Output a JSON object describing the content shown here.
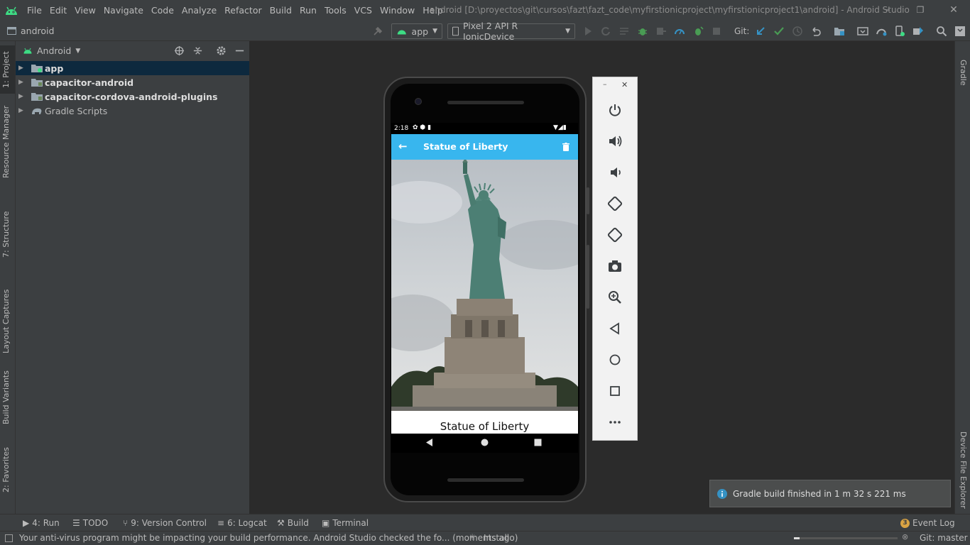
{
  "window": {
    "menu": [
      "File",
      "Edit",
      "View",
      "Navigate",
      "Code",
      "Analyze",
      "Refactor",
      "Build",
      "Run",
      "Tools",
      "VCS",
      "Window",
      "Help"
    ],
    "title": "android [D:\\proyectos\\git\\cursos\\fazt\\fazt_code\\myfirstionicproject\\myfirstionicproject1\\android] - Android Studio",
    "minimize": "–",
    "restore": "❐",
    "close": "✕"
  },
  "toolbar": {
    "breadcrumb": "android",
    "run_config": "app",
    "device": "Pixel 2 API R IonicDevice",
    "git_label": "Git:"
  },
  "left_tabs": [
    "1: Project",
    "Resource Manager",
    "7: Structure",
    "Layout Captures",
    "Build Variants",
    "2: Favorites"
  ],
  "right_tabs": [
    "Gradle",
    "Device File Explorer"
  ],
  "project_panel": {
    "view": "Android",
    "tree": [
      {
        "label": "app",
        "selected": true
      },
      {
        "label": "capacitor-android",
        "selected": false
      },
      {
        "label": "capacitor-cordova-android-plugins",
        "selected": false
      },
      {
        "label": "Gradle Scripts",
        "selected": false
      }
    ]
  },
  "emulator": {
    "status_time": "2:18",
    "app_title": "Statue of Liberty",
    "caption": "Statue of Liberty",
    "panel_icons": [
      "power-icon",
      "volume-up-icon",
      "volume-down-icon",
      "rotate-left-icon",
      "rotate-right-icon",
      "camera-icon",
      "zoom-icon",
      "back-icon",
      "home-icon",
      "overview-icon",
      "more-icon"
    ]
  },
  "notification": {
    "text": "Gradle build finished in 1 m 32 s 221 ms"
  },
  "tool_windows": {
    "run": "4: Run",
    "todo": "TODO",
    "vcs": "9: Version Control",
    "logcat": "6: Logcat",
    "build": "Build",
    "terminal": "Terminal",
    "event_log": "Event Log",
    "event_count": "3"
  },
  "status": {
    "message": "Your anti-virus program might be impacting your build performance. Android Studio checked the fo... (moments ago)",
    "task": "Install",
    "git_branch": "Git: master"
  },
  "colors": {
    "ide_bg": "#3c3f41",
    "editor_bg": "#2b2b2b",
    "app_bar": "#38b6ee",
    "android_green": "#3ddc84",
    "selection": "#0d293e"
  }
}
